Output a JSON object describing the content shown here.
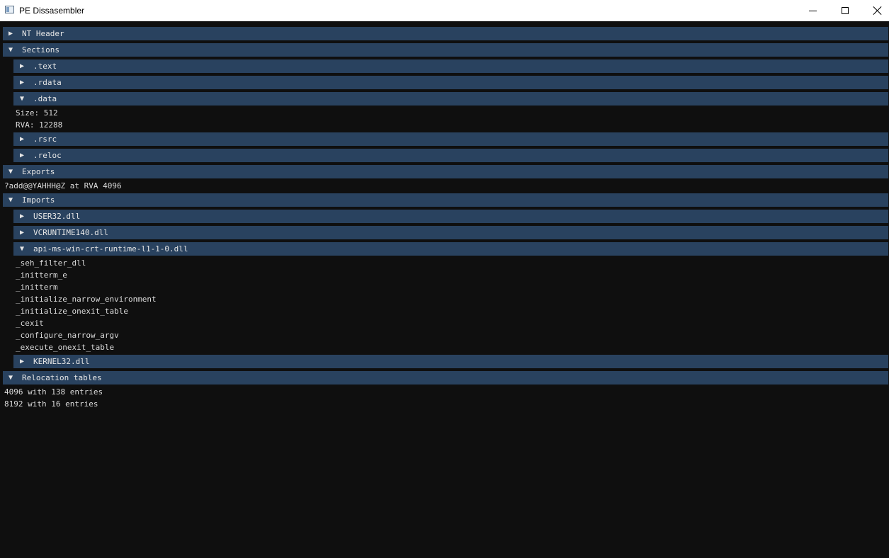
{
  "window": {
    "title": "PE Dissasembler",
    "buttons": {
      "minimize": "",
      "maximize": "",
      "close": ""
    }
  },
  "icons": {
    "collapsed_arrow": "▶",
    "expanded_arrow": "▼"
  },
  "tree": {
    "nt_header": {
      "label": "NT Header"
    },
    "sections": {
      "label": "Sections",
      "text": {
        "label": ".text"
      },
      "rdata": {
        "label": ".rdata"
      },
      "data": {
        "label": ".data",
        "size": "Size: 512",
        "rva": "RVA: 12288"
      },
      "rsrc": {
        "label": ".rsrc"
      },
      "reloc": {
        "label": ".reloc"
      }
    },
    "exports": {
      "label": "Exports",
      "items": [
        "?add@@YAHHH@Z at RVA 4096"
      ]
    },
    "imports": {
      "label": "Imports",
      "user32": {
        "label": "USER32.dll"
      },
      "vcruntime": {
        "label": "VCRUNTIME140.dll"
      },
      "api_crt": {
        "label": "api-ms-win-crt-runtime-l1-1-0.dll",
        "functions": [
          "_seh_filter_dll",
          "_initterm_e",
          "_initterm",
          "_initialize_narrow_environment",
          "_initialize_onexit_table",
          "_cexit",
          "_configure_narrow_argv",
          "_execute_onexit_table"
        ]
      },
      "kernel32": {
        "label": "KERNEL32.dll"
      }
    },
    "relocations": {
      "label": "Relocation tables",
      "items": [
        "4096 with 138 entries",
        "8192 with 16 entries"
      ]
    }
  },
  "colors": {
    "background": "#0f0f0f",
    "header": "#29425f",
    "text": "#dcdcdc"
  }
}
